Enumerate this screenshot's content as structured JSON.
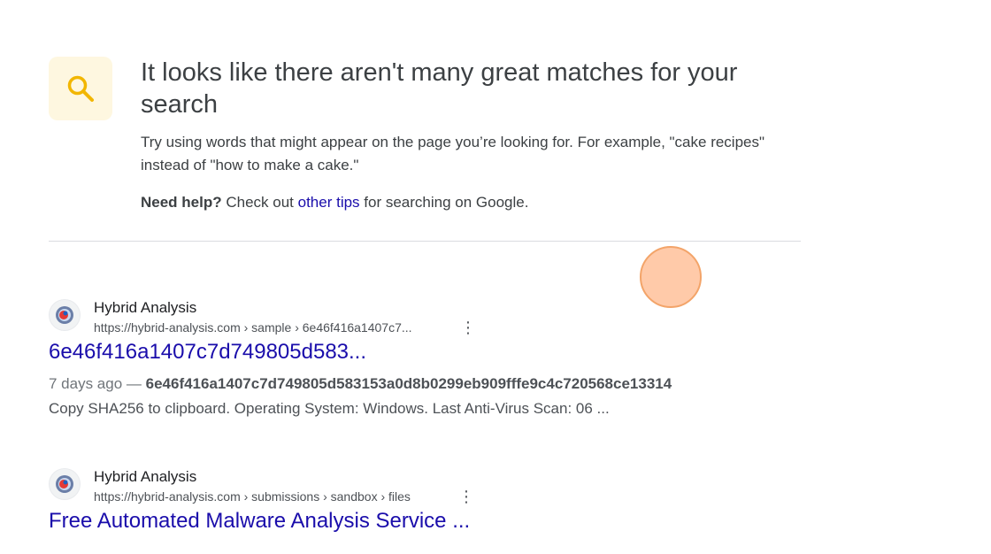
{
  "notice": {
    "title": "It looks like there aren't many great matches for your search",
    "body": "Try using words that might appear on the page you’re looking for. For example, \"cake recipes\" instead of \"how to make a cake.\"",
    "help_bold": "Need help?",
    "help_prefix": " Check out ",
    "help_link": "other tips",
    "help_suffix": " for searching on Google."
  },
  "results": [
    {
      "site_name": "Hybrid Analysis",
      "url": "https://hybrid-analysis.com › sample › 6e46f416a1407c7...",
      "title": "6e46f416a1407c7d749805d583...",
      "date": "7 days ago — ",
      "hash": "6e46f416a1407c7d749805d583153a0d8b0299eb909fffe9c4c720568ce13314",
      "snippet": "Copy SHA256 to clipboard. Operating System: Windows. Last Anti-Virus Scan: 06 ..."
    },
    {
      "site_name": "Hybrid Analysis",
      "url": "https://hybrid-analysis.com › submissions › sandbox › files",
      "title": "Free Automated Malware Analysis Service ..."
    }
  ],
  "colors": {
    "link": "#1a0dab",
    "notice_icon_bg": "#fef7e0",
    "notice_icon": "#f2b600",
    "cursor": "#ffc4a0"
  }
}
